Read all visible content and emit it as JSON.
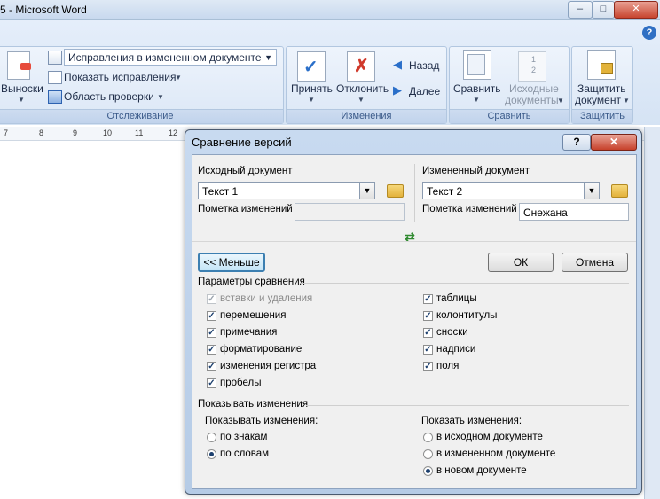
{
  "window": {
    "title": "5 - Microsoft Word",
    "buttons": {
      "minimize": "–",
      "maximize": "□",
      "close": "✕"
    },
    "help": "?"
  },
  "ribbon": {
    "balloons_label": "Выноски",
    "tracking_display_value": "Исправления в измененном документе",
    "show_markup_label": "Показать исправления",
    "reviewing_pane_label": "Область проверки",
    "tracking_group": "Отслеживание",
    "accept_label": "Принять",
    "reject_label": "Отклонить",
    "previous_label": "Назад",
    "next_label": "Далее",
    "changes_group": "Изменения",
    "compare_label": "Сравнить",
    "source_docs_label_1": "Исходные",
    "source_docs_label_2": "документы",
    "compare_group": "Сравнить",
    "protect_label_1": "Защитить",
    "protect_label_2": "документ",
    "protect_group": "Защитить"
  },
  "ruler": [
    "7",
    "8",
    "9",
    "10",
    "11",
    "12"
  ],
  "dialog": {
    "title": "Сравнение версий",
    "help": "?",
    "close": "✕",
    "original": {
      "label": "Исходный документ",
      "value": "Текст 1",
      "label_changes": "Пометка изменений",
      "changes_value": ""
    },
    "revised": {
      "label": "Измененный документ",
      "value": "Текст 2",
      "label_changes": "Пометка изменений",
      "changes_value": "Снежана"
    },
    "less_button": "<< Меньше",
    "ok_button": "ОК",
    "cancel_button": "Отмена",
    "compare_settings_title": "Параметры сравнения",
    "left_options": [
      {
        "label": "вставки и удаления",
        "checked": true,
        "disabled": true
      },
      {
        "label": "перемещения",
        "checked": true,
        "disabled": false
      },
      {
        "label": "примечания",
        "checked": true,
        "disabled": false
      },
      {
        "label": "форматирование",
        "checked": true,
        "disabled": false
      },
      {
        "label": "изменения регистра",
        "checked": true,
        "disabled": false
      },
      {
        "label": "пробелы",
        "checked": true,
        "disabled": false
      }
    ],
    "right_options": [
      {
        "label": "таблицы",
        "checked": true
      },
      {
        "label": "колонтитулы",
        "checked": true
      },
      {
        "label": "сноски",
        "checked": true
      },
      {
        "label": "надписи",
        "checked": true
      },
      {
        "label": "поля",
        "checked": true
      }
    ],
    "show_changes_title": "Показывать изменения",
    "show_changes_at_label": "Показывать изменения:",
    "show_at_options": [
      {
        "label": "по знакам",
        "selected": false
      },
      {
        "label": "по словам",
        "selected": true
      }
    ],
    "show_in_label": "Показать изменения:",
    "show_in_options": [
      {
        "label": "в исходном документе",
        "selected": false
      },
      {
        "label": "в измененном документе",
        "selected": false
      },
      {
        "label": "в новом документе",
        "selected": true
      }
    ]
  }
}
